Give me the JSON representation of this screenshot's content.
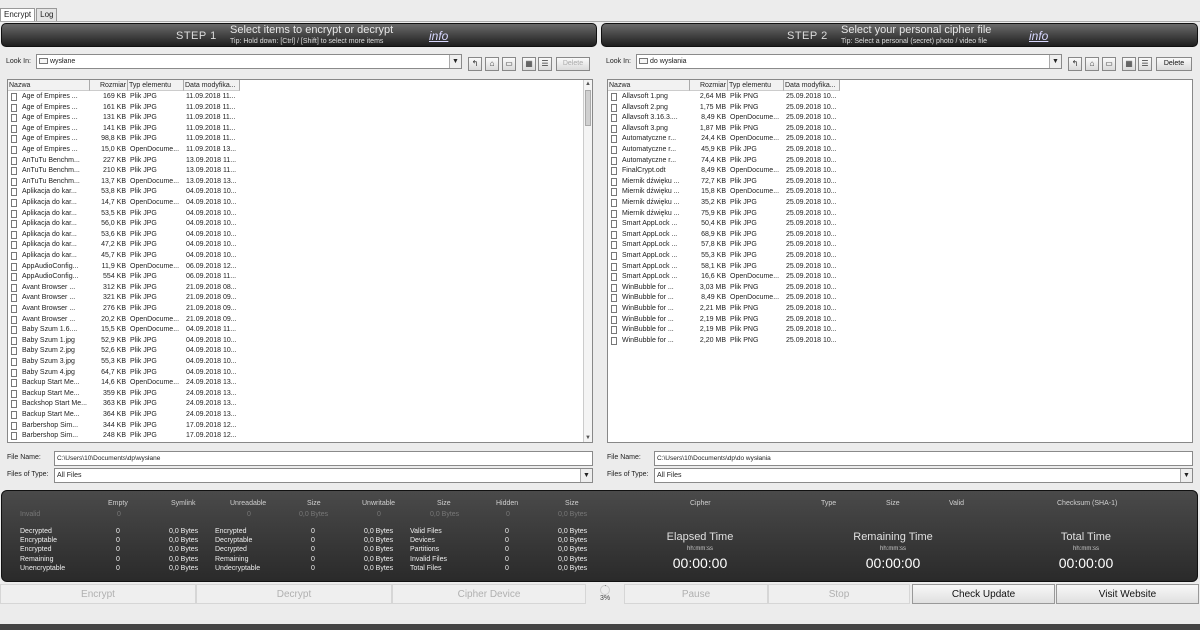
{
  "tabs": [
    {
      "label": "Encrypt",
      "active": true
    },
    {
      "label": "Log",
      "active": false
    }
  ],
  "step1": {
    "num": "STEP 1",
    "title": "Select items to encrypt or decrypt",
    "tip": "Tip: Hold down: [Ctrl] / [Shift] to select more items",
    "info": "info",
    "look_in_label": "Look In:",
    "look_in_value": "wysłane",
    "delete": "Delete",
    "file_name_label": "File Name:",
    "file_name_value": "C:\\Users\\10\\Documents\\dp\\wysłane",
    "files_type_label": "Files of Type:",
    "files_type_value": "All Files",
    "columns": [
      "Nazwa",
      "Rozmiar",
      "Typ elementu",
      "Data modyfika..."
    ],
    "rows": [
      [
        "Age of Empires ...",
        "169 KB",
        "Plik JPG",
        "11.09.2018 11..."
      ],
      [
        "Age of Empires ...",
        "161 KB",
        "Plik JPG",
        "11.09.2018 11..."
      ],
      [
        "Age of Empires ...",
        "131 KB",
        "Plik JPG",
        "11.09.2018 11..."
      ],
      [
        "Age of Empires ...",
        "141 KB",
        "Plik JPG",
        "11.09.2018 11..."
      ],
      [
        "Age of Empires ...",
        "98,8 KB",
        "Plik JPG",
        "11.09.2018 11..."
      ],
      [
        "Age of Empires ...",
        "15,0 KB",
        "OpenDocume...",
        "11.09.2018 13..."
      ],
      [
        "AnTuTu Benchm...",
        "227 KB",
        "Plik JPG",
        "13.09.2018 11..."
      ],
      [
        "AnTuTu Benchm...",
        "210 KB",
        "Plik JPG",
        "13.09.2018 11..."
      ],
      [
        "AnTuTu Benchm...",
        "13,7 KB",
        "OpenDocume...",
        "13.09.2018 13..."
      ],
      [
        "Aplikacja do kar...",
        "53,8 KB",
        "Plik JPG",
        "04.09.2018 10..."
      ],
      [
        "Aplikacja do kar...",
        "14,7 KB",
        "OpenDocume...",
        "04.09.2018 10..."
      ],
      [
        "Aplikacja do kar...",
        "53,5 KB",
        "Plik JPG",
        "04.09.2018 10..."
      ],
      [
        "Aplikacja do kar...",
        "56,0 KB",
        "Plik JPG",
        "04.09.2018 10..."
      ],
      [
        "Aplikacja do kar...",
        "53,6 KB",
        "Plik JPG",
        "04.09.2018 10..."
      ],
      [
        "Aplikacja do kar...",
        "47,2 KB",
        "Plik JPG",
        "04.09.2018 10..."
      ],
      [
        "Aplikacja do kar...",
        "45,7 KB",
        "Plik JPG",
        "04.09.2018 10..."
      ],
      [
        "AppAudioConfig...",
        "11,9 KB",
        "OpenDocume...",
        "06.09.2018 12..."
      ],
      [
        "AppAudioConfig...",
        "554 KB",
        "Plik JPG",
        "06.09.2018 11..."
      ],
      [
        "Avant Browser ...",
        "312 KB",
        "Plik JPG",
        "21.09.2018 08..."
      ],
      [
        "Avant Browser ...",
        "321 KB",
        "Plik JPG",
        "21.09.2018 09..."
      ],
      [
        "Avant Browser ...",
        "276 KB",
        "Plik JPG",
        "21.09.2018 09..."
      ],
      [
        "Avant Browser ...",
        "20,2 KB",
        "OpenDocume...",
        "21.09.2018 09..."
      ],
      [
        "Baby Szum 1.6....",
        "15,5 KB",
        "OpenDocume...",
        "04.09.2018 11..."
      ],
      [
        "Baby Szum 1.jpg",
        "52,9 KB",
        "Plik JPG",
        "04.09.2018 10..."
      ],
      [
        "Baby Szum 2.jpg",
        "52,6 KB",
        "Plik JPG",
        "04.09.2018 10..."
      ],
      [
        "Baby Szum 3.jpg",
        "55,3 KB",
        "Plik JPG",
        "04.09.2018 10..."
      ],
      [
        "Baby Szum 4.jpg",
        "64,7 KB",
        "Plik JPG",
        "04.09.2018 10..."
      ],
      [
        "Backup Start Me...",
        "14,6 KB",
        "OpenDocume...",
        "24.09.2018 13..."
      ],
      [
        "Backup Start Me...",
        "359 KB",
        "Plik JPG",
        "24.09.2018 13..."
      ],
      [
        "Backshop Start Me...",
        "363 KB",
        "Plik JPG",
        "24.09.2018 13..."
      ],
      [
        "Backup Start Me...",
        "364 KB",
        "Plik JPG",
        "24.09.2018 13..."
      ],
      [
        "Barbershop Sim...",
        "344 KB",
        "Plik JPG",
        "17.09.2018 12..."
      ],
      [
        "Barbershop Sim...",
        "248 KB",
        "Plik JPG",
        "17.09.2018 12..."
      ]
    ]
  },
  "step2": {
    "num": "STEP 2",
    "title": "Select your personal cipher file",
    "tip": "Tip: Select a personal (secret) photo / video file",
    "info": "info",
    "look_in_label": "Look In:",
    "look_in_value": "do wysłania",
    "delete": "Delete",
    "file_name_label": "File Name:",
    "file_name_value": "C:\\Users\\10\\Documents\\dp\\do wysłania",
    "files_type_label": "Files of Type:",
    "files_type_value": "All Files",
    "columns": [
      "Nazwa",
      "Rozmiar",
      "Typ elementu",
      "Data modyfika..."
    ],
    "rows": [
      [
        "Allavsoft 1.png",
        "2,64 MB",
        "Plik PNG",
        "25.09.2018 10..."
      ],
      [
        "Allavsoft 2.png",
        "1,75 MB",
        "Plik PNG",
        "25.09.2018 10..."
      ],
      [
        "Allavsoft 3.16.3....",
        "8,49 KB",
        "OpenDocume...",
        "25.09.2018 10..."
      ],
      [
        "Allavsoft 3.png",
        "1,87 MB",
        "Plik PNG",
        "25.09.2018 10..."
      ],
      [
        "Automatyczne r...",
        "24,4 KB",
        "OpenDocume...",
        "25.09.2018 10..."
      ],
      [
        "Automatyczne r...",
        "45,9 KB",
        "Plik JPG",
        "25.09.2018 10..."
      ],
      [
        "Automatyczne r...",
        "74,4 KB",
        "Plik JPG",
        "25.09.2018 10..."
      ],
      [
        "FinalCrypt.odt",
        "8,49 KB",
        "OpenDocume...",
        "25.09.2018 10..."
      ],
      [
        "Miernik dźwięku ...",
        "72,7 KB",
        "Plik JPG",
        "25.09.2018 10..."
      ],
      [
        "Miernik dźwięku ...",
        "15,8 KB",
        "OpenDocume...",
        "25.09.2018 10..."
      ],
      [
        "Miernik dźwięku ...",
        "35,2 KB",
        "Plik JPG",
        "25.09.2018 10..."
      ],
      [
        "Miernik dźwięku ...",
        "75,9 KB",
        "Plik JPG",
        "25.09.2018 10..."
      ],
      [
        "Smart AppLock ...",
        "50,4 KB",
        "Plik JPG",
        "25.09.2018 10..."
      ],
      [
        "Smart AppLock ...",
        "68,9 KB",
        "Plik JPG",
        "25.09.2018 10..."
      ],
      [
        "Smart AppLock ...",
        "57,8 KB",
        "Plik JPG",
        "25.09.2018 10..."
      ],
      [
        "Smart AppLock ...",
        "55,3 KB",
        "Plik JPG",
        "25.09.2018 10..."
      ],
      [
        "Smart AppLock ...",
        "58,1 KB",
        "Plik JPG",
        "25.09.2018 10..."
      ],
      [
        "Smart AppLock ...",
        "16,6 KB",
        "OpenDocume...",
        "25.09.2018 10..."
      ],
      [
        "WinBubble for ...",
        "3,03 MB",
        "Plik PNG",
        "25.09.2018 10..."
      ],
      [
        "WinBubble for ...",
        "8,49 KB",
        "OpenDocume...",
        "25.09.2018 10..."
      ],
      [
        "WinBubble for ...",
        "2,21 MB",
        "Plik PNG",
        "25.09.2018 10..."
      ],
      [
        "WinBubble for ...",
        "2,19 MB",
        "Plik PNG",
        "25.09.2018 10..."
      ],
      [
        "WinBubble for ...",
        "2,19 MB",
        "Plik PNG",
        "25.09.2018 10..."
      ],
      [
        "WinBubble for ...",
        "2,20 MB",
        "Plik PNG",
        "25.09.2018 10..."
      ]
    ]
  },
  "stats": {
    "headers": [
      "Empty",
      "Symlink",
      "Unreadable",
      "Size",
      "Unwritable",
      "Size",
      "Hidden",
      "Size",
      "Cipher",
      "Type",
      "Size",
      "Valid",
      "Checksum (SHA-1)"
    ],
    "ghost": [
      "Invalid",
      "0",
      "0",
      "0,0 Bytes",
      "0",
      "0,0 Bytes",
      "0",
      "0,0 Bytes"
    ],
    "col1_labels": [
      "Decrypted",
      "Encryptable",
      "Encrypted",
      "Remaining",
      "Unencryptable"
    ],
    "col1_counts": [
      "0",
      "0",
      "0",
      "0",
      "0"
    ],
    "col1_sizes": [
      "0,0 Bytes",
      "0,0 Bytes",
      "0,0 Bytes",
      "0,0 Bytes",
      "0,0 Bytes"
    ],
    "col2_labels": [
      "Encrypted",
      "Decryptable",
      "Decrypted",
      "Remaining",
      "Undecryptable"
    ],
    "col2_counts": [
      "0",
      "0",
      "0",
      "0",
      "0"
    ],
    "col2_sizes": [
      "0,0 Bytes",
      "0,0 Bytes",
      "0,0 Bytes",
      "0,0 Bytes",
      "0,0 Bytes"
    ],
    "col3_labels": [
      "Valid Files",
      "Devices",
      "Partitions",
      "Invalid Files",
      "Total Files"
    ],
    "col3_counts": [
      "0",
      "0",
      "0",
      "0",
      "0"
    ],
    "col3_sizes": [
      "0,0 Bytes",
      "0,0 Bytes",
      "0,0 Bytes",
      "0,0 Bytes",
      "0,0 Bytes"
    ],
    "elapsed": {
      "label": "Elapsed Time",
      "format": "hh:mm:ss",
      "value": "00:00:00"
    },
    "remaining": {
      "label": "Remaining Time",
      "format": "hh:mm:ss",
      "value": "00:00:00"
    },
    "total": {
      "label": "Total Time",
      "format": "hh:mm:ss",
      "value": "00:00:00"
    }
  },
  "buttons": {
    "encrypt": "Encrypt",
    "decrypt": "Decrypt",
    "cipher_device": "Cipher Device",
    "progress": "3%",
    "progress_value": 0.03,
    "pause": "Pause",
    "stop": "Stop",
    "check_update": "Check Update",
    "visit_website": "Visit Website"
  }
}
